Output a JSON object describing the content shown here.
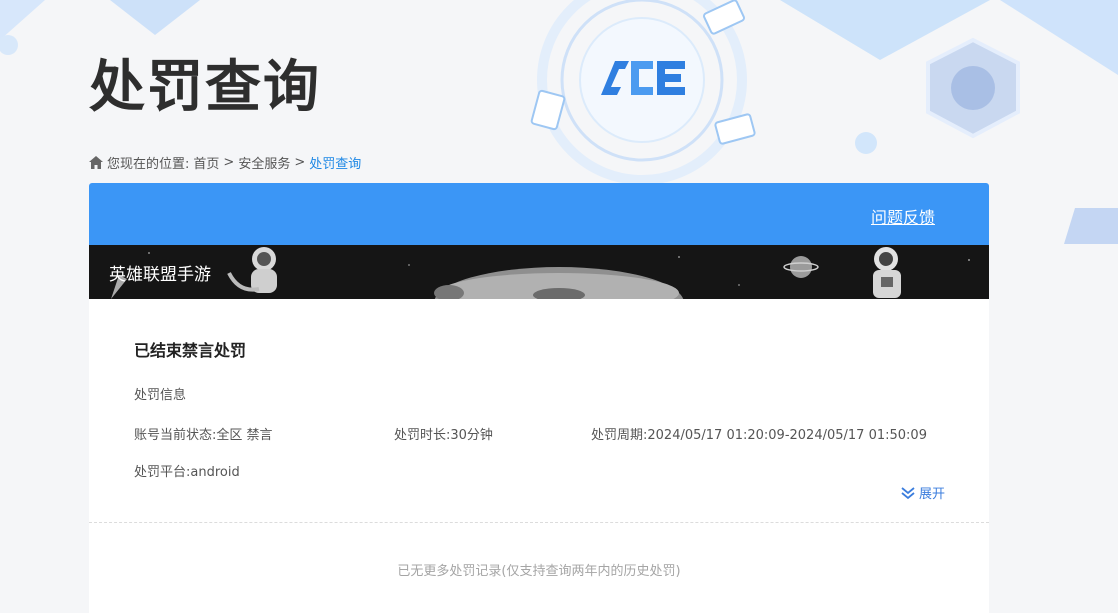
{
  "page": {
    "title": "处罚查询"
  },
  "breadcrumb": {
    "prefix": "您现在的位置:",
    "items": [
      "首页",
      "安全服务",
      "处罚查询"
    ],
    "separator": ">"
  },
  "header": {
    "feedback_label": "问题反馈"
  },
  "banner": {
    "game_name": "英雄联盟手游"
  },
  "record": {
    "title": "已结束禁言处罚",
    "section_label": "处罚信息",
    "status": "账号当前状态:全区 禁言",
    "duration": "处罚时长:30分钟",
    "period": "处罚周期:2024/05/17 01:20:09-2024/05/17 01:50:09",
    "platform": "处罚平台:android",
    "expand_label": "展开"
  },
  "footer": {
    "no_more": "已无更多处罚记录(仅支持查询两年内的历史处罚)"
  },
  "colors": {
    "header_blue": "#3b96f6",
    "link_blue": "#1e88e5",
    "title_dark": "#2e2e2e"
  },
  "icons": {
    "home": "home-icon",
    "expand": "double-chevron-down-icon",
    "logo": "ace-logo"
  }
}
